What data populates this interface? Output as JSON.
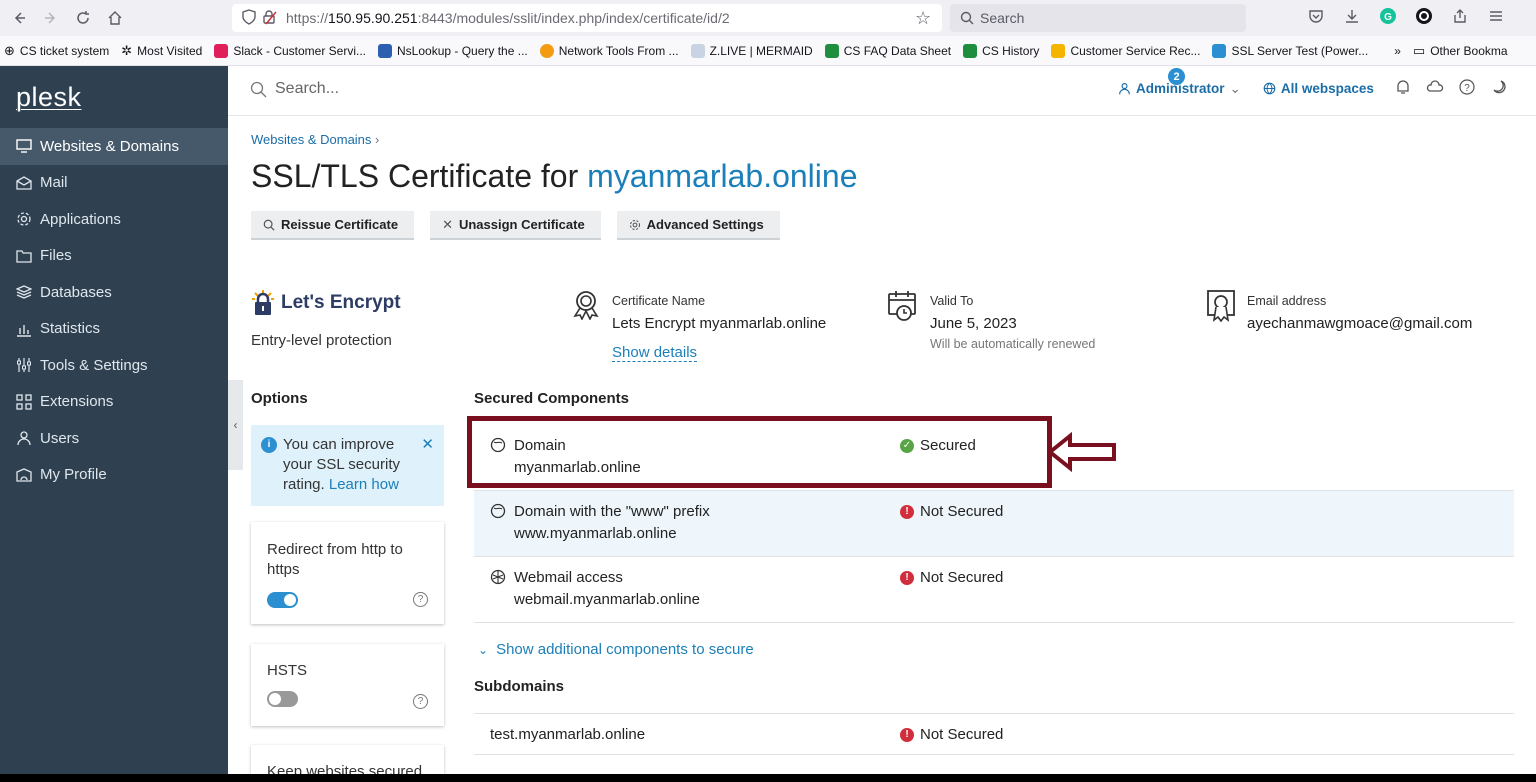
{
  "browser": {
    "url_prefix": "https://",
    "url_host": "150.95.90.251",
    "url_rest": ":8443/modules/sslit/index.php/index/certificate/id/2",
    "search_placeholder": "Search",
    "bookmarks": [
      {
        "label": "CS ticket system",
        "color": "#6b6b75"
      },
      {
        "label": "Most Visited",
        "color": "#6b6b75"
      },
      {
        "label": "Slack - Customer Servi...",
        "color": "#e01e5a"
      },
      {
        "label": "NsLookup - Query the ...",
        "color": "#2d5fb0"
      },
      {
        "label": "Network Tools From ...",
        "color": "#f39c12"
      },
      {
        "label": "Z.LIVE | MERMAID",
        "color": "#8aa4c8"
      },
      {
        "label": "CS FAQ Data Sheet",
        "color": "#1e8e3e"
      },
      {
        "label": "CS History",
        "color": "#1e8e3e"
      },
      {
        "label": "Customer Service Rec...",
        "color": "#f4b400"
      },
      {
        "label": "SSL Server Test (Power...",
        "color": "#2b8fd1"
      },
      {
        "label": "Other Bookma",
        "color": "#6b6b75"
      }
    ]
  },
  "sidebar": {
    "brand": "plesk",
    "items": [
      {
        "label": "Websites & Domains",
        "icon": "monitor-icon",
        "active": true
      },
      {
        "label": "Mail",
        "icon": "mail-icon"
      },
      {
        "label": "Applications",
        "icon": "gear-icon"
      },
      {
        "label": "Files",
        "icon": "folder-icon"
      },
      {
        "label": "Databases",
        "icon": "database-icon"
      },
      {
        "label": "Statistics",
        "icon": "bar-chart-icon"
      },
      {
        "label": "Tools & Settings",
        "icon": "sliders-icon"
      },
      {
        "label": "Extensions",
        "icon": "grid-icon"
      },
      {
        "label": "Users",
        "icon": "user-icon"
      },
      {
        "label": "My Profile",
        "icon": "profile-icon"
      }
    ]
  },
  "topbar": {
    "search_placeholder": "Search...",
    "user": "Administrator",
    "webspaces": "All webspaces",
    "notifications": "2"
  },
  "page": {
    "breadcrumb": "Websites & Domains",
    "title_prefix": "SSL/TLS Certificate for",
    "title_domain": "myanmarlab.online",
    "actions": {
      "reissue": "Reissue Certificate",
      "unassign": "Unassign Certificate",
      "advanced": "Advanced Settings"
    }
  },
  "certificate": {
    "issuer": "Let's Encrypt",
    "protection": "Entry-level protection",
    "name_label": "Certificate Name",
    "name_value": "Lets Encrypt myanmarlab.online",
    "show_details": "Show details",
    "valid_label": "Valid To",
    "valid_value": "June 5, 2023",
    "valid_note": "Will be automatically renewed",
    "email_label": "Email address",
    "email_value": "ayechanmawgmoace@gmail.com"
  },
  "options": {
    "heading": "Options",
    "tip_text": "You can improve your SSL security rating.",
    "tip_link": "Learn how",
    "redirect_label": "Redirect from http to https",
    "hsts_label": "HSTS",
    "keep_label": "Keep websites secured"
  },
  "secured": {
    "heading": "Secured Components",
    "rows": [
      {
        "name": "Domain",
        "value": "myanmarlab.online",
        "status": "Secured",
        "icon": "globe-icon"
      },
      {
        "name": "Domain with the \"www\" prefix",
        "value": "www.myanmarlab.online",
        "status": "Not Secured",
        "icon": "globe-icon"
      },
      {
        "name": "Webmail access",
        "value": "webmail.myanmarlab.online",
        "status": "Not Secured",
        "icon": "webmail-icon"
      }
    ],
    "show_more": "Show additional components to secure"
  },
  "subdomains": {
    "heading": "Subdomains",
    "rows": [
      {
        "value": "test.myanmarlab.online",
        "status": "Not Secured"
      }
    ]
  },
  "colors": {
    "sidebar": "#2f4050",
    "accent": "#1b7fb9",
    "secured": "#57a545",
    "not_secured": "#d02e3c",
    "annotation": "#7a0f1f"
  }
}
